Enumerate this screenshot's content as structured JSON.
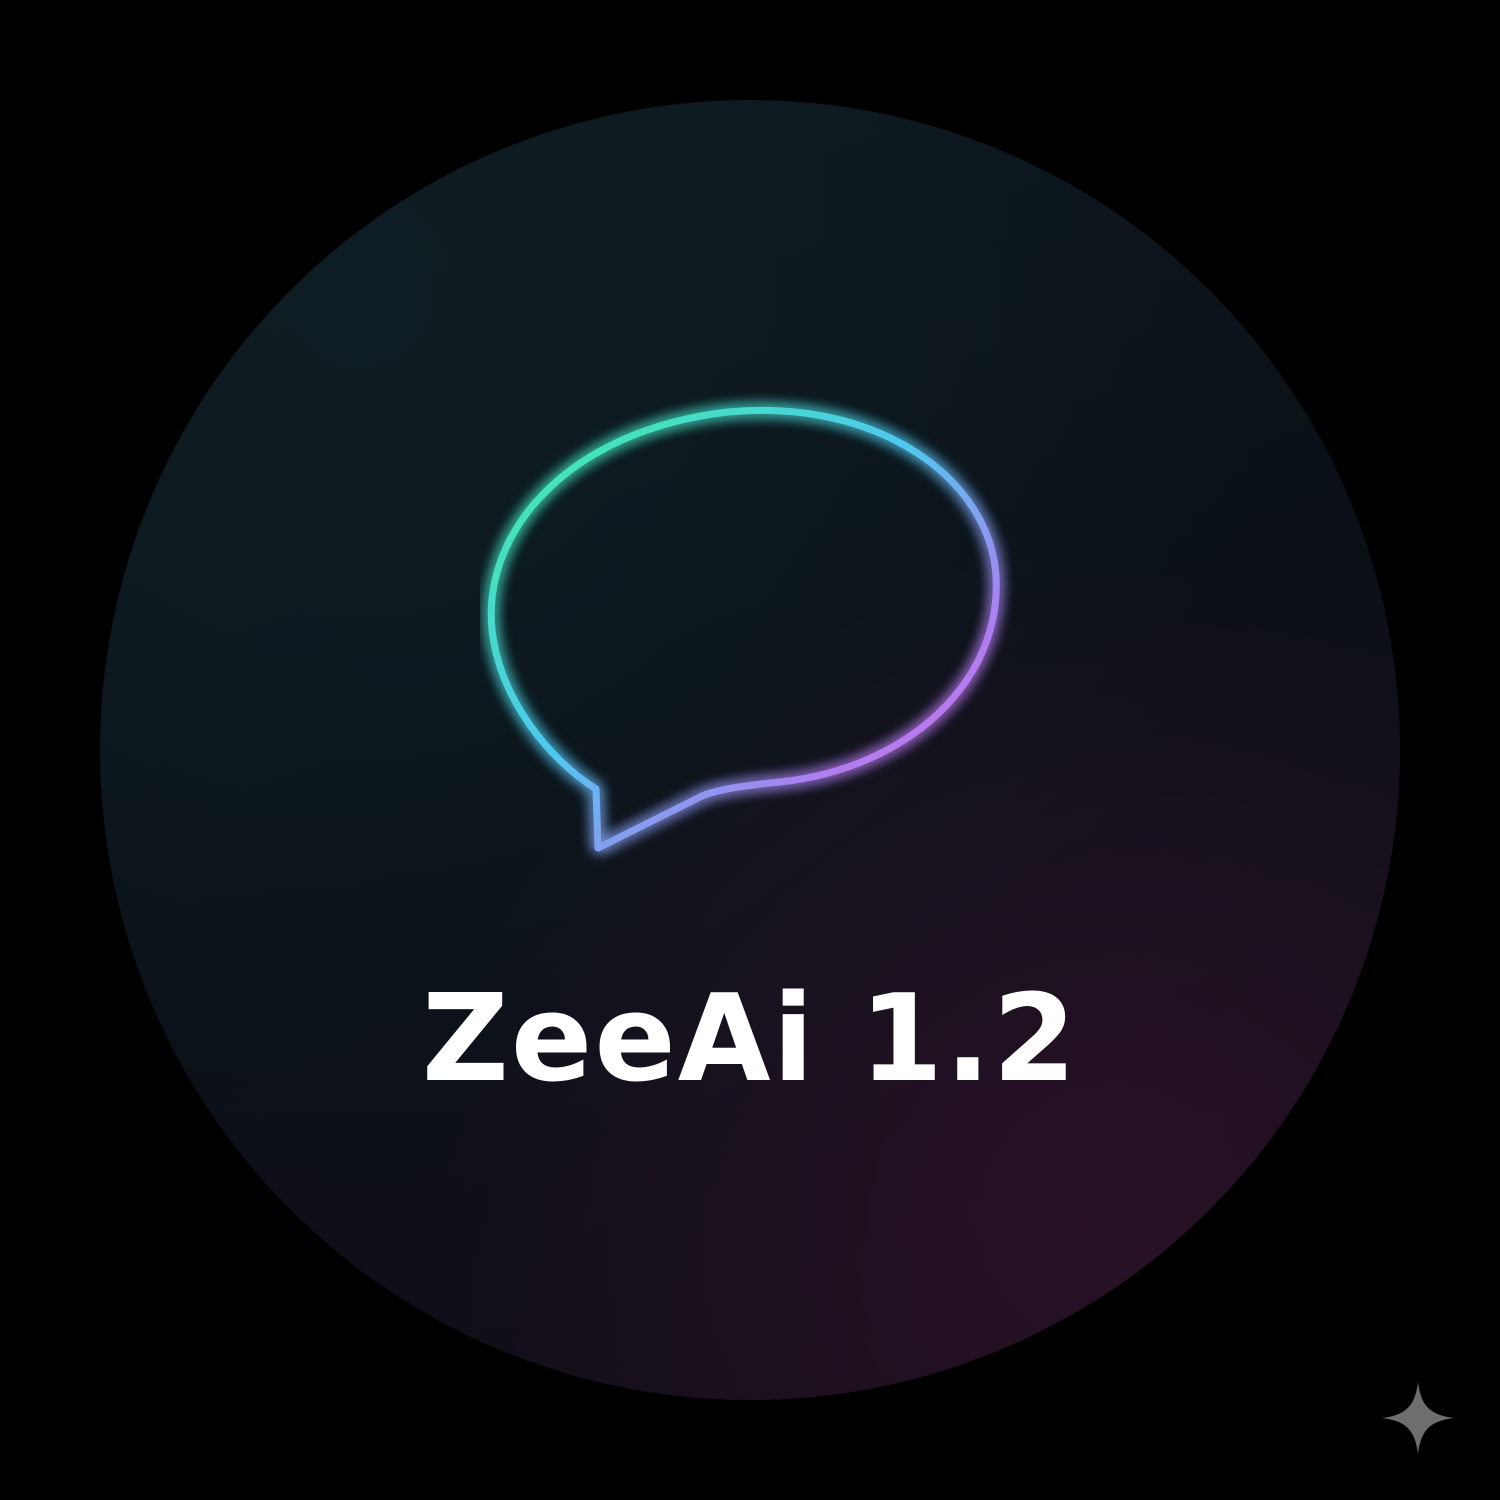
{
  "app": {
    "title": "ZeeAi 1.2"
  },
  "logo": {
    "icon": "speech-bubble-soundwave-icon",
    "gradient": [
      "#3ef0a0",
      "#4fc8f0",
      "#b07cf0",
      "#e070e0"
    ]
  },
  "corner": {
    "icon": "sparkle-icon",
    "color": "#6e6e6e"
  },
  "colors": {
    "background": "#000000",
    "circle": "#0b1017",
    "title": "#ffffff"
  }
}
